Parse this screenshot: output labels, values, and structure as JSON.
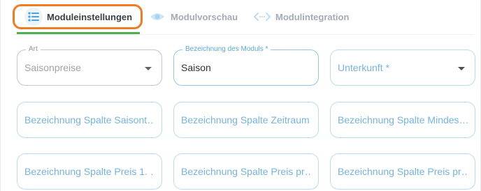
{
  "tabs": [
    {
      "label": "Moduleinstellungen",
      "icon": "list-icon",
      "active": true
    },
    {
      "label": "Modulvorschau",
      "icon": "eye-icon",
      "active": false
    },
    {
      "label": "Modulintegration",
      "icon": "code-icon",
      "active": false
    }
  ],
  "colors": {
    "highlight": "#f07b26",
    "active_underline": "#4caf50",
    "field_border": "#b7dcf2",
    "label_blue": "#74b4e4"
  },
  "form": {
    "art": {
      "label": "Art",
      "value": "Saisonpreise"
    },
    "bezeichnung": {
      "label": "Bezeichnung des Moduls *",
      "value": "Saison"
    },
    "unterkunft": {
      "placeholder": "Unterkunft *"
    },
    "row2": [
      "Bezeichnung Spalte Saisont…",
      "Bezeichnung Spalte Zeitraum",
      "Bezeichnung Spalte Mindes…"
    ],
    "row3": [
      "Bezeichnung Spalte Preis 1. …",
      "Bezeichnung Spalte Preis pr…",
      "Bezeichnung Spalte Preis pr…"
    ]
  }
}
